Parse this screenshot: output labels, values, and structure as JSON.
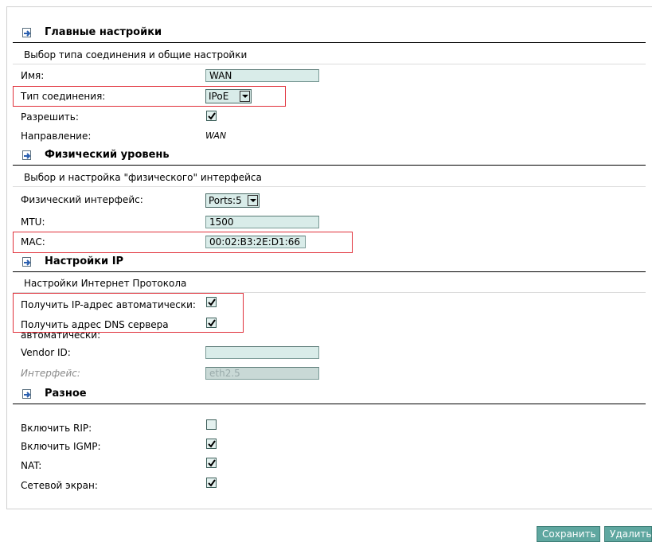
{
  "sections": {
    "main": {
      "title": "Главные настройки",
      "subtitle": "Выбор типа соединения и общие настройки",
      "name_label": "Имя:",
      "name_value": "WAN",
      "conn_type_label": "Тип соединения:",
      "conn_type_value": "IPoE",
      "enable_label": "Разрешить:",
      "enable_checked": true,
      "direction_label": "Направление:",
      "direction_value": "WAN"
    },
    "physical": {
      "title": "Физический уровень",
      "subtitle": "Выбор и настройка \"физического\" интерфейса",
      "iface_label": "Физический интерфейс:",
      "iface_value": "Ports:5",
      "mtu_label": "MTU:",
      "mtu_value": "1500",
      "mac_label": "MAC:",
      "mac_value": "00:02:B3:2E:D1:66"
    },
    "ip": {
      "title": "Настройки IP",
      "subtitle": "Настройки Интернет Протокола",
      "auto_ip_label": "Получить IP-адрес автоматически:",
      "auto_ip_checked": true,
      "auto_dns_label_1": "Получить адрес DNS сервера",
      "auto_dns_label_2": "автоматически:",
      "auto_dns_checked": true,
      "vendor_label": "Vendor ID:",
      "vendor_value": "",
      "iface_label": "Интерфейс:",
      "iface_value": "eth2.5"
    },
    "misc": {
      "title": "Разное",
      "rip_label": "Включить RIP:",
      "rip_checked": false,
      "igmp_label": "Включить IGMP:",
      "igmp_checked": true,
      "nat_label": "NAT:",
      "nat_checked": true,
      "firewall_label": "Сетевой экран:",
      "firewall_checked": true
    }
  },
  "buttons": {
    "save": "Сохранить",
    "delete": "Удалить"
  },
  "colors": {
    "highlight": "#e0303a",
    "button": "#5fa7a0",
    "field": "#d9ece9"
  }
}
